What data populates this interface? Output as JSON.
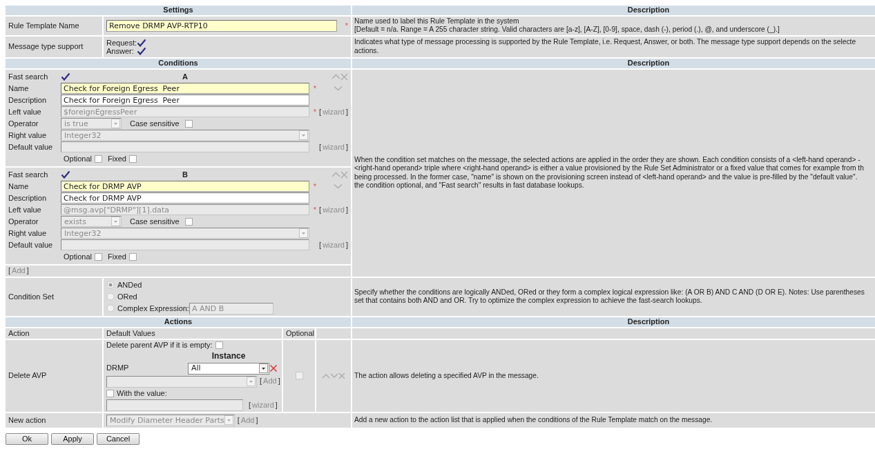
{
  "settings": {
    "title": "Settings",
    "description_title": "Description",
    "name_row": {
      "label": "Rule Template Name",
      "value": "Remove DRMP AVP-RTP10",
      "highlighted": true,
      "required_mark": "*",
      "description": [
        "Name used to label this Rule Template in the system",
        "[Default = n/a. Range = A 255 character string. Valid characters are [a-z], [A-Z], [0-9], space, dash (-), period (.), @, and underscore (_).]"
      ]
    },
    "message_type_row": {
      "label": "Message type support",
      "options": [
        {
          "label": "Request:",
          "checked": true
        },
        {
          "label": "Answer:",
          "checked": true
        }
      ],
      "description": [
        "Indicates what type of message processing is supported by the Rule Template, i.e. Request, Answer, or both. The message type support depends on the selecte",
        "actions."
      ]
    }
  },
  "conditions": {
    "title": "Conditions",
    "description_title": "Description",
    "items": [
      {
        "letter": "A",
        "fast_search": {
          "label": "Fast search",
          "checked": true
        },
        "rows": [
          {
            "kind": "input",
            "label": "Name",
            "value": "Check for Foreign Egress  Peer",
            "highlighted": true,
            "disabled": false,
            "required_mark": "*"
          },
          {
            "kind": "input",
            "label": "Description",
            "value": "Check for Foreign Egress  Peer",
            "highlighted": false,
            "disabled": false
          },
          {
            "kind": "input",
            "label": "Left value",
            "value": "$foreignEgressPeer",
            "highlighted": false,
            "disabled": true,
            "required_mark": "*",
            "link": "[wizard]"
          },
          {
            "kind": "operator",
            "label": "Operator",
            "value": "is true",
            "checkbox": {
              "label": "Case sensitive",
              "checked": false
            }
          },
          {
            "kind": "select",
            "label": "Right value",
            "value": "Integer32"
          },
          {
            "kind": "input",
            "label": "Default value",
            "highlighted": false,
            "disabled": true,
            "link": "[wizard]"
          },
          {
            "kind": "flags",
            "flags": [
              {
                "label": "Optional",
                "checked": false
              },
              {
                "label": "Fixed",
                "checked": false
              }
            ]
          }
        ]
      },
      {
        "letter": "B",
        "fast_search": {
          "label": "Fast search",
          "checked": true
        },
        "rows": [
          {
            "kind": "input",
            "label": "Name",
            "value": "Check for DRMP AVP",
            "highlighted": true,
            "disabled": false,
            "required_mark": "*"
          },
          {
            "kind": "input",
            "label": "Description",
            "value": "Check for DRMP AVP",
            "highlighted": false,
            "disabled": false
          },
          {
            "kind": "input",
            "label": "Left value",
            "value": "@msg.avp[\"DRMP\"][1].data",
            "highlighted": false,
            "disabled": true,
            "required_mark": "*",
            "link": "[wizard]"
          },
          {
            "kind": "operator",
            "label": "Operator",
            "value": "exists",
            "checkbox": {
              "label": "Case sensitive",
              "checked": false
            }
          },
          {
            "kind": "select",
            "label": "Right value",
            "value": "Integer32"
          },
          {
            "kind": "input",
            "label": "Default value",
            "highlighted": false,
            "disabled": true,
            "link": "[wizard]"
          },
          {
            "kind": "flags",
            "flags": [
              {
                "label": "Optional",
                "checked": false
              },
              {
                "label": "Fixed",
                "checked": false
              }
            ]
          }
        ]
      }
    ],
    "add_link": "[Add]",
    "description": [
      "When the condition set matches on the message, the selected actions are applied in the order they are shown. Each condition consists of a <left-hand operand> -",
      "<right-hand operand> triple where <right-hand operand> is either a value provisioned by the Rule Set Administrator or a fixed value that comes for example from th",
      "being processed. In the former case, \"name\" is shown on the provisioning screen instead of <left-hand operand> and the value is pre-filled by the \"default value\".",
      "the condition optional, and \"Fast search\" results in fast database lookups."
    ]
  },
  "condition_set": {
    "label": "Condition Set",
    "options": [
      {
        "label": "ANDed",
        "selected": true
      },
      {
        "label": "ORed",
        "selected": false
      },
      {
        "label": "Complex Expression:",
        "selected": false,
        "value": "A AND B"
      }
    ],
    "description": [
      "Specify whether the conditions are logically ANDed, ORed or they form a complex logical expression like: (A OR B) AND C AND (D OR E). Notes: Use parentheses",
      "set that contains both AND and OR. Try to optimize the complex expression to achieve the fast-search lookups."
    ]
  },
  "actions": {
    "title": "Actions",
    "description_title": "Description",
    "columns": [
      "Action",
      "Default Values",
      "Optional"
    ],
    "items": [
      {
        "kind": "delete_avp",
        "label": "Delete AVP",
        "parent_option": {
          "label": "Delete parent AVP if it is empty:",
          "checked": false
        },
        "instance_title": "Instance",
        "avp_name": "DRMP",
        "instance": "All",
        "add_link": "[Add]",
        "value_option": {
          "label": "With the value:",
          "checked": false
        },
        "wizard_link": "[wizard]",
        "optional": false,
        "description": "The action allows deleting a specified AVP in the message."
      }
    ],
    "new_action": {
      "label": "New action",
      "value": "Modify Diameter Header Parts",
      "add_link": "[Add]",
      "description": "Add a new action to the action list that is applied when the conditions of the Rule Template match on the message."
    }
  },
  "buttons": [
    "Ok",
    "Apply",
    "Cancel"
  ]
}
